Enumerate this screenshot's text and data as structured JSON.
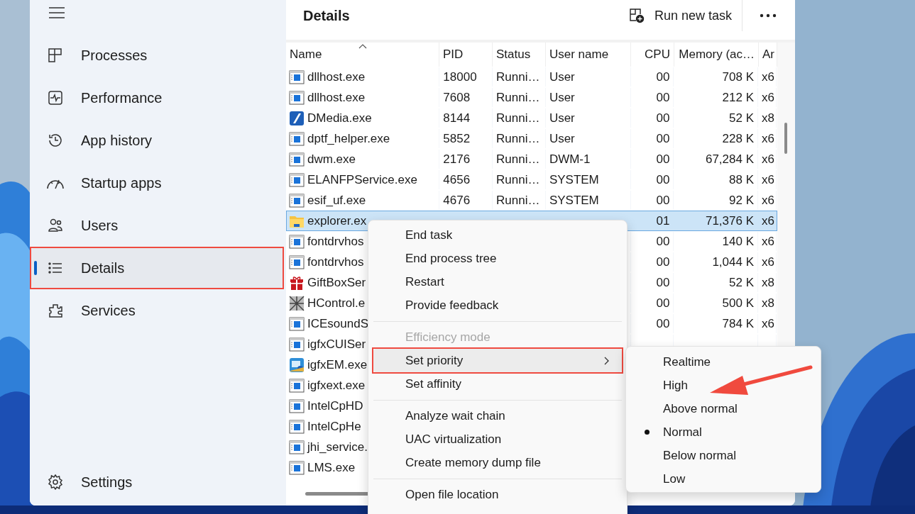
{
  "sidebar": {
    "items": [
      {
        "label": "Processes",
        "selected": false,
        "annotated": false
      },
      {
        "label": "Performance",
        "selected": false,
        "annotated": false
      },
      {
        "label": "App history",
        "selected": false,
        "annotated": false
      },
      {
        "label": "Startup apps",
        "selected": false,
        "annotated": false
      },
      {
        "label": "Users",
        "selected": false,
        "annotated": false
      },
      {
        "label": "Details",
        "selected": true,
        "annotated": true
      },
      {
        "label": "Services",
        "selected": false,
        "annotated": false
      }
    ],
    "footer_item": {
      "label": "Settings"
    }
  },
  "header": {
    "title": "Details",
    "action": "Run new task"
  },
  "table": {
    "columns": [
      {
        "label": "Name",
        "sorted": true
      },
      {
        "label": "PID",
        "sorted": false
      },
      {
        "label": "Status",
        "sorted": false
      },
      {
        "label": "User name",
        "sorted": false
      },
      {
        "label": "CPU",
        "sorted": false
      },
      {
        "label": "Memory (ac…",
        "sorted": false
      },
      {
        "label": "Ar",
        "sorted": false
      }
    ],
    "rows": [
      {
        "kind": "app",
        "name": "dllhost.exe",
        "pid": "18000",
        "status": "Runni…",
        "user": "User",
        "cpu": "00",
        "memory": "708 K",
        "arch": "x6",
        "selected": false
      },
      {
        "kind": "app",
        "name": "dllhost.exe",
        "pid": "7608",
        "status": "Runni…",
        "user": "User",
        "cpu": "00",
        "memory": "212 K",
        "arch": "x6",
        "selected": false
      },
      {
        "kind": "media",
        "name": "DMedia.exe",
        "pid": "8144",
        "status": "Runni…",
        "user": "User",
        "cpu": "00",
        "memory": "52 K",
        "arch": "x8",
        "selected": false
      },
      {
        "kind": "app",
        "name": "dptf_helper.exe",
        "pid": "5852",
        "status": "Runni…",
        "user": "User",
        "cpu": "00",
        "memory": "228 K",
        "arch": "x6",
        "selected": false
      },
      {
        "kind": "app",
        "name": "dwm.exe",
        "pid": "2176",
        "status": "Runni…",
        "user": "DWM-1",
        "cpu": "00",
        "memory": "67,284 K",
        "arch": "x6",
        "selected": false
      },
      {
        "kind": "app",
        "name": "ELANFPService.exe",
        "pid": "4656",
        "status": "Runni…",
        "user": "SYSTEM",
        "cpu": "00",
        "memory": "88 K",
        "arch": "x6",
        "selected": false
      },
      {
        "kind": "app",
        "name": "esif_uf.exe",
        "pid": "4676",
        "status": "Runni…",
        "user": "SYSTEM",
        "cpu": "00",
        "memory": "92 K",
        "arch": "x6",
        "selected": false
      },
      {
        "kind": "folder",
        "name": "explorer.ex",
        "cpu": "01",
        "memory": "71,376 K",
        "arch": "x6",
        "selected": true
      },
      {
        "kind": "app",
        "name": "fontdrvhos",
        "cpu": "00",
        "memory": "140 K",
        "arch": "x6",
        "selected": false
      },
      {
        "kind": "app",
        "name": "fontdrvhos",
        "cpu": "00",
        "memory": "1,044 K",
        "arch": "x6",
        "selected": false
      },
      {
        "kind": "gift",
        "name": "GiftBoxSer",
        "cpu": "00",
        "memory": "52 K",
        "arch": "x8",
        "selected": false
      },
      {
        "kind": "pattern",
        "name": "HControl.e",
        "cpu": "00",
        "memory": "500 K",
        "arch": "x8",
        "selected": false
      },
      {
        "kind": "app",
        "name": "ICEsoundS",
        "cpu": "00",
        "memory": "784 K",
        "arch": "x6",
        "selected": false
      },
      {
        "kind": "app",
        "name": "igfxCUISer",
        "selected": false
      },
      {
        "kind": "monitor",
        "name": "igfxEM.exe",
        "selected": false
      },
      {
        "kind": "app",
        "name": "igfxext.exe",
        "selected": false
      },
      {
        "kind": "app",
        "name": "IntelCpHD",
        "selected": false
      },
      {
        "kind": "app",
        "name": "IntelCpHe",
        "selected": false
      },
      {
        "kind": "app",
        "name": "jhi_service.",
        "selected": false
      },
      {
        "kind": "app",
        "name": "LMS.exe",
        "selected": false
      }
    ]
  },
  "context_menu": {
    "groups": [
      [
        {
          "label": "End task",
          "disabled": false,
          "highlighted": false,
          "has_submenu": false,
          "annotated": false
        },
        {
          "label": "End process tree",
          "disabled": false,
          "highlighted": false,
          "has_submenu": false,
          "annotated": false
        },
        {
          "label": "Restart",
          "disabled": false,
          "highlighted": false,
          "has_submenu": false,
          "annotated": false
        },
        {
          "label": "Provide feedback",
          "disabled": false,
          "highlighted": false,
          "has_submenu": false,
          "annotated": false
        }
      ],
      [
        {
          "label": "Efficiency mode",
          "disabled": true,
          "highlighted": false,
          "has_submenu": false,
          "annotated": false
        },
        {
          "label": "Set priority",
          "disabled": false,
          "highlighted": true,
          "has_submenu": true,
          "annotated": true
        },
        {
          "label": "Set affinity",
          "disabled": false,
          "highlighted": false,
          "has_submenu": false,
          "annotated": false
        }
      ],
      [
        {
          "label": "Analyze wait chain",
          "disabled": false,
          "highlighted": false,
          "has_submenu": false,
          "annotated": false
        },
        {
          "label": "UAC virtualization",
          "disabled": false,
          "highlighted": false,
          "has_submenu": false,
          "annotated": false
        },
        {
          "label": "Create memory dump file",
          "disabled": false,
          "highlighted": false,
          "has_submenu": false,
          "annotated": false
        }
      ],
      [
        {
          "label": "Open file location",
          "disabled": false,
          "highlighted": false,
          "has_submenu": false,
          "annotated": false
        }
      ]
    ]
  },
  "submenu": {
    "items": [
      {
        "label": "Realtime",
        "selected": false,
        "annotated": false
      },
      {
        "label": "High",
        "selected": false,
        "annotated": true
      },
      {
        "label": "Above normal",
        "selected": false,
        "annotated": false
      },
      {
        "label": "Normal",
        "selected": true,
        "annotated": false
      },
      {
        "label": "Below normal",
        "selected": false,
        "annotated": false
      },
      {
        "label": "Low",
        "selected": false,
        "annotated": false
      }
    ]
  }
}
